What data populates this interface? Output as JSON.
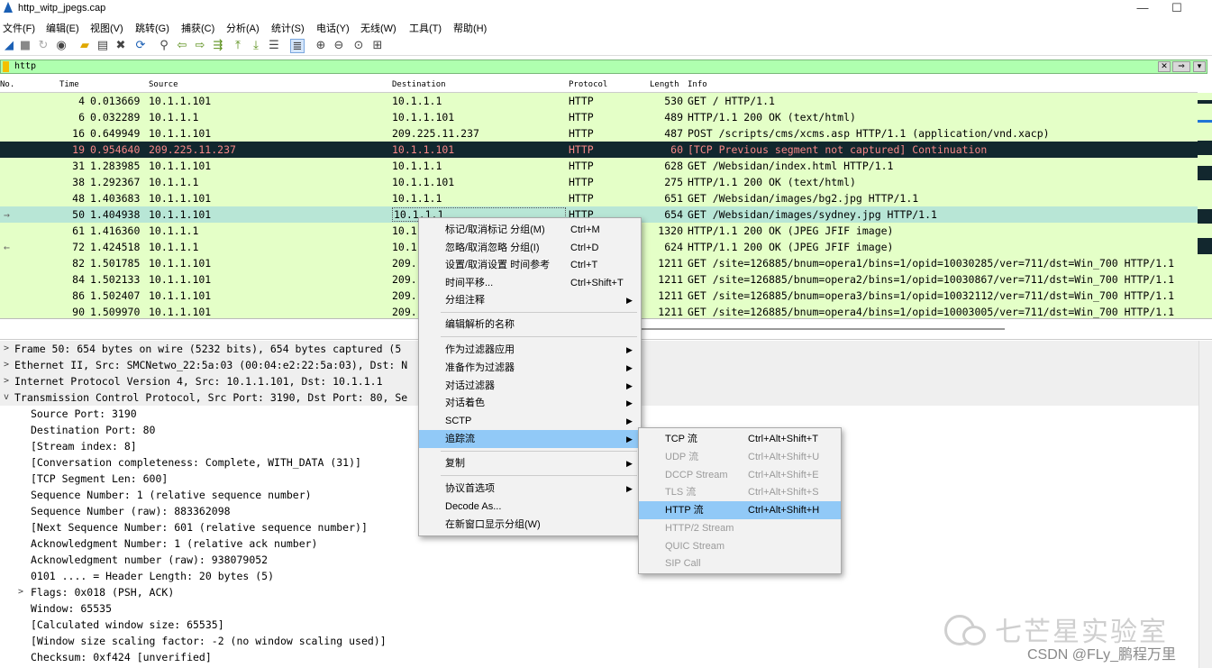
{
  "window": {
    "title": "http_witp_jpegs.cap",
    "minimize": "—",
    "maximize": "☐"
  },
  "menu": [
    "文件(F)",
    "编辑(E)",
    "视图(V)",
    "跳转(G)",
    "捕获(C)",
    "分析(A)",
    "统计(S)",
    "电话(Y)",
    "无线(W)",
    "工具(T)",
    "帮助(H)"
  ],
  "toolbar_icons": [
    "shark-fin-start-icon",
    "stop-icon",
    "restart-icon",
    "options-gear-icon",
    "open-folder-icon",
    "file-icon",
    "close-file-icon",
    "reload-icon",
    "find-icon",
    "back-arrow-icon",
    "forward-arrow-icon",
    "goto-packet-icon",
    "first-packet-icon",
    "last-packet-icon",
    "autoscroll-icon",
    "colorize-icon",
    "zoom-in-icon",
    "zoom-out-icon",
    "normal-size-icon",
    "resize-columns-icon"
  ],
  "filter": {
    "value": "http"
  },
  "columns": {
    "no": "No.",
    "time": "Time",
    "source": "Source",
    "destination": "Destination",
    "protocol": "Protocol",
    "length": "Length",
    "info": "Info"
  },
  "packets": [
    {
      "no": "4",
      "time": "0.013669",
      "src": "10.1.1.101",
      "dst": "10.1.1.1",
      "proto": "HTTP",
      "len": "530",
      "info": "GET / HTTP/1.1"
    },
    {
      "no": "6",
      "time": "0.032289",
      "src": "10.1.1.1",
      "dst": "10.1.1.101",
      "proto": "HTTP",
      "len": "489",
      "info": "HTTP/1.1 200 OK  (text/html)"
    },
    {
      "no": "16",
      "time": "0.649949",
      "src": "10.1.1.101",
      "dst": "209.225.11.237",
      "proto": "HTTP",
      "len": "487",
      "info": "POST /scripts/cms/xcms.asp HTTP/1.1  (application/vnd.xacp)"
    },
    {
      "no": "19",
      "time": "0.954640",
      "src": "209.225.11.237",
      "dst": "10.1.1.101",
      "proto": "HTTP",
      "len": "60",
      "info": "[TCP Previous segment not captured] Continuation"
    },
    {
      "no": "31",
      "time": "1.283985",
      "src": "10.1.1.101",
      "dst": "10.1.1.1",
      "proto": "HTTP",
      "len": "628",
      "info": "GET /Websidan/index.html HTTP/1.1"
    },
    {
      "no": "38",
      "time": "1.292367",
      "src": "10.1.1.1",
      "dst": "10.1.1.101",
      "proto": "HTTP",
      "len": "275",
      "info": "HTTP/1.1 200 OK  (text/html)"
    },
    {
      "no": "48",
      "time": "1.403683",
      "src": "10.1.1.101",
      "dst": "10.1.1.1",
      "proto": "HTTP",
      "len": "651",
      "info": "GET /Websidan/images/bg2.jpg HTTP/1.1"
    },
    {
      "no": "50",
      "time": "1.404938",
      "src": "10.1.1.101",
      "dst": "10.1.1.1",
      "proto": "HTTP",
      "len": "654",
      "info": "GET /Websidan/images/sydney.jpg HTTP/1.1"
    },
    {
      "no": "61",
      "time": "1.416360",
      "src": "10.1.1.1",
      "dst": "10.1",
      "proto": "",
      "len": "1320",
      "info": "HTTP/1.1 200 OK  (JPEG JFIF image)"
    },
    {
      "no": "72",
      "time": "1.424518",
      "src": "10.1.1.1",
      "dst": "10.1",
      "proto": "",
      "len": "624",
      "info": "HTTP/1.1 200 OK  (JPEG JFIF image)"
    },
    {
      "no": "82",
      "time": "1.501785",
      "src": "10.1.1.101",
      "dst": "209.",
      "proto": "",
      "len": "1211",
      "info": "GET /site=126885/bnum=opera1/bins=1/opid=10030285/ver=711/dst=Win_700 HTTP/1.1"
    },
    {
      "no": "84",
      "time": "1.502133",
      "src": "10.1.1.101",
      "dst": "209.",
      "proto": "",
      "len": "1211",
      "info": "GET /site=126885/bnum=opera2/bins=1/opid=10030867/ver=711/dst=Win_700 HTTP/1.1"
    },
    {
      "no": "86",
      "time": "1.502407",
      "src": "10.1.1.101",
      "dst": "209.",
      "proto": "",
      "len": "1211",
      "info": "GET /site=126885/bnum=opera3/bins=1/opid=10032112/ver=711/dst=Win_700 HTTP/1.1"
    },
    {
      "no": "90",
      "time": "1.509970",
      "src": "10.1.1.101",
      "dst": "209.",
      "proto": "",
      "len": "1211",
      "info": "GET /site=126885/bnum=opera4/bins=1/opid=10003005/ver=711/dst=Win_700 HTTP/1.1"
    }
  ],
  "details": [
    {
      "text": "Frame 50: 654 bytes on wire (5232 bits), 654 bytes captured (5",
      "arrow": ">"
    },
    {
      "text": "Ethernet II, Src: SMCNetwo_22:5a:03 (00:04:e2:22:5a:03), Dst: N",
      "arrow": ">"
    },
    {
      "text": "Internet Protocol Version 4, Src: 10.1.1.101, Dst: 10.1.1.1",
      "arrow": ">"
    },
    {
      "text": "Transmission Control Protocol, Src Port: 3190, Dst Port: 80, Se",
      "arrow": "v"
    },
    {
      "text": "Source Port: 3190",
      "arrow": ""
    },
    {
      "text": "Destination Port: 80",
      "arrow": ""
    },
    {
      "text": "[Stream index: 8]",
      "arrow": ""
    },
    {
      "text": "[Conversation completeness: Complete, WITH_DATA (31)]",
      "arrow": ""
    },
    {
      "text": "[TCP Segment Len: 600]",
      "arrow": ""
    },
    {
      "text": "Sequence Number: 1    (relative sequence number)",
      "arrow": ""
    },
    {
      "text": "Sequence Number (raw): 883362098",
      "arrow": ""
    },
    {
      "text": "[Next Sequence Number: 601    (relative sequence number)]",
      "arrow": ""
    },
    {
      "text": "Acknowledgment Number: 1    (relative ack number)",
      "arrow": ""
    },
    {
      "text": "Acknowledgment number (raw): 938079052",
      "arrow": ""
    },
    {
      "text": "0101 .... = Header Length: 20 bytes (5)",
      "arrow": ""
    },
    {
      "text": "Flags: 0x018 (PSH, ACK)",
      "arrow": ">"
    },
    {
      "text": "Window: 65535",
      "arrow": ""
    },
    {
      "text": "[Calculated window size: 65535]",
      "arrow": ""
    },
    {
      "text": "[Window size scaling factor: -2 (no window scaling used)]",
      "arrow": ""
    },
    {
      "text": "Checksum: 0xf424 [unverified]",
      "arrow": ""
    }
  ],
  "context_menu": [
    {
      "label": "标记/取消标记 分组(M)",
      "shortcut": "Ctrl+M"
    },
    {
      "label": "忽略/取消忽略 分组(I)",
      "shortcut": "Ctrl+D"
    },
    {
      "label": "设置/取消设置 时间参考",
      "shortcut": "Ctrl+T"
    },
    {
      "label": "时间平移...",
      "shortcut": "Ctrl+Shift+T"
    },
    {
      "label": "分组注释",
      "shortcut": "",
      "submenu": true
    },
    {
      "label": "编辑解析的名称",
      "shortcut": ""
    },
    {
      "label": "作为过滤器应用",
      "shortcut": "",
      "submenu": true
    },
    {
      "label": "准备作为过滤器",
      "shortcut": "",
      "submenu": true
    },
    {
      "label": "对话过滤器",
      "shortcut": "",
      "submenu": true
    },
    {
      "label": "对话着色",
      "shortcut": "",
      "submenu": true
    },
    {
      "label": "SCTP",
      "shortcut": "",
      "submenu": true
    },
    {
      "label": "追踪流",
      "shortcut": "",
      "submenu": true
    },
    {
      "label": "复制",
      "shortcut": "",
      "submenu": true
    },
    {
      "label": "协议首选项",
      "shortcut": "",
      "submenu": true
    },
    {
      "label": "Decode As...",
      "shortcut": ""
    },
    {
      "label": "在新窗口显示分组(W)",
      "shortcut": ""
    }
  ],
  "submenu": [
    {
      "label": "TCP 流",
      "shortcut": "Ctrl+Alt+Shift+T",
      "enabled": true
    },
    {
      "label": "UDP 流",
      "shortcut": "Ctrl+Alt+Shift+U",
      "enabled": false
    },
    {
      "label": "DCCP Stream",
      "shortcut": "Ctrl+Alt+Shift+E",
      "enabled": false
    },
    {
      "label": "TLS 流",
      "shortcut": "Ctrl+Alt+Shift+S",
      "enabled": false
    },
    {
      "label": "HTTP 流",
      "shortcut": "Ctrl+Alt+Shift+H",
      "enabled": true
    },
    {
      "label": "HTTP/2 Stream",
      "shortcut": "",
      "enabled": false
    },
    {
      "label": "QUIC Stream",
      "shortcut": "",
      "enabled": false
    },
    {
      "label": "SIP Call",
      "shortcut": "",
      "enabled": false
    }
  ],
  "watermark": {
    "title": "七芒星实验室",
    "byline": "CSDN @FLy_鹏程万里"
  },
  "colors": {
    "http_row": "#e4ffc7",
    "bad_row_bg": "#12272e",
    "bad_row_fg": "#f78787",
    "current_row": "#b8e6d6",
    "menu_highlight": "#91c9f7",
    "filter_ok": "#afffaf"
  }
}
